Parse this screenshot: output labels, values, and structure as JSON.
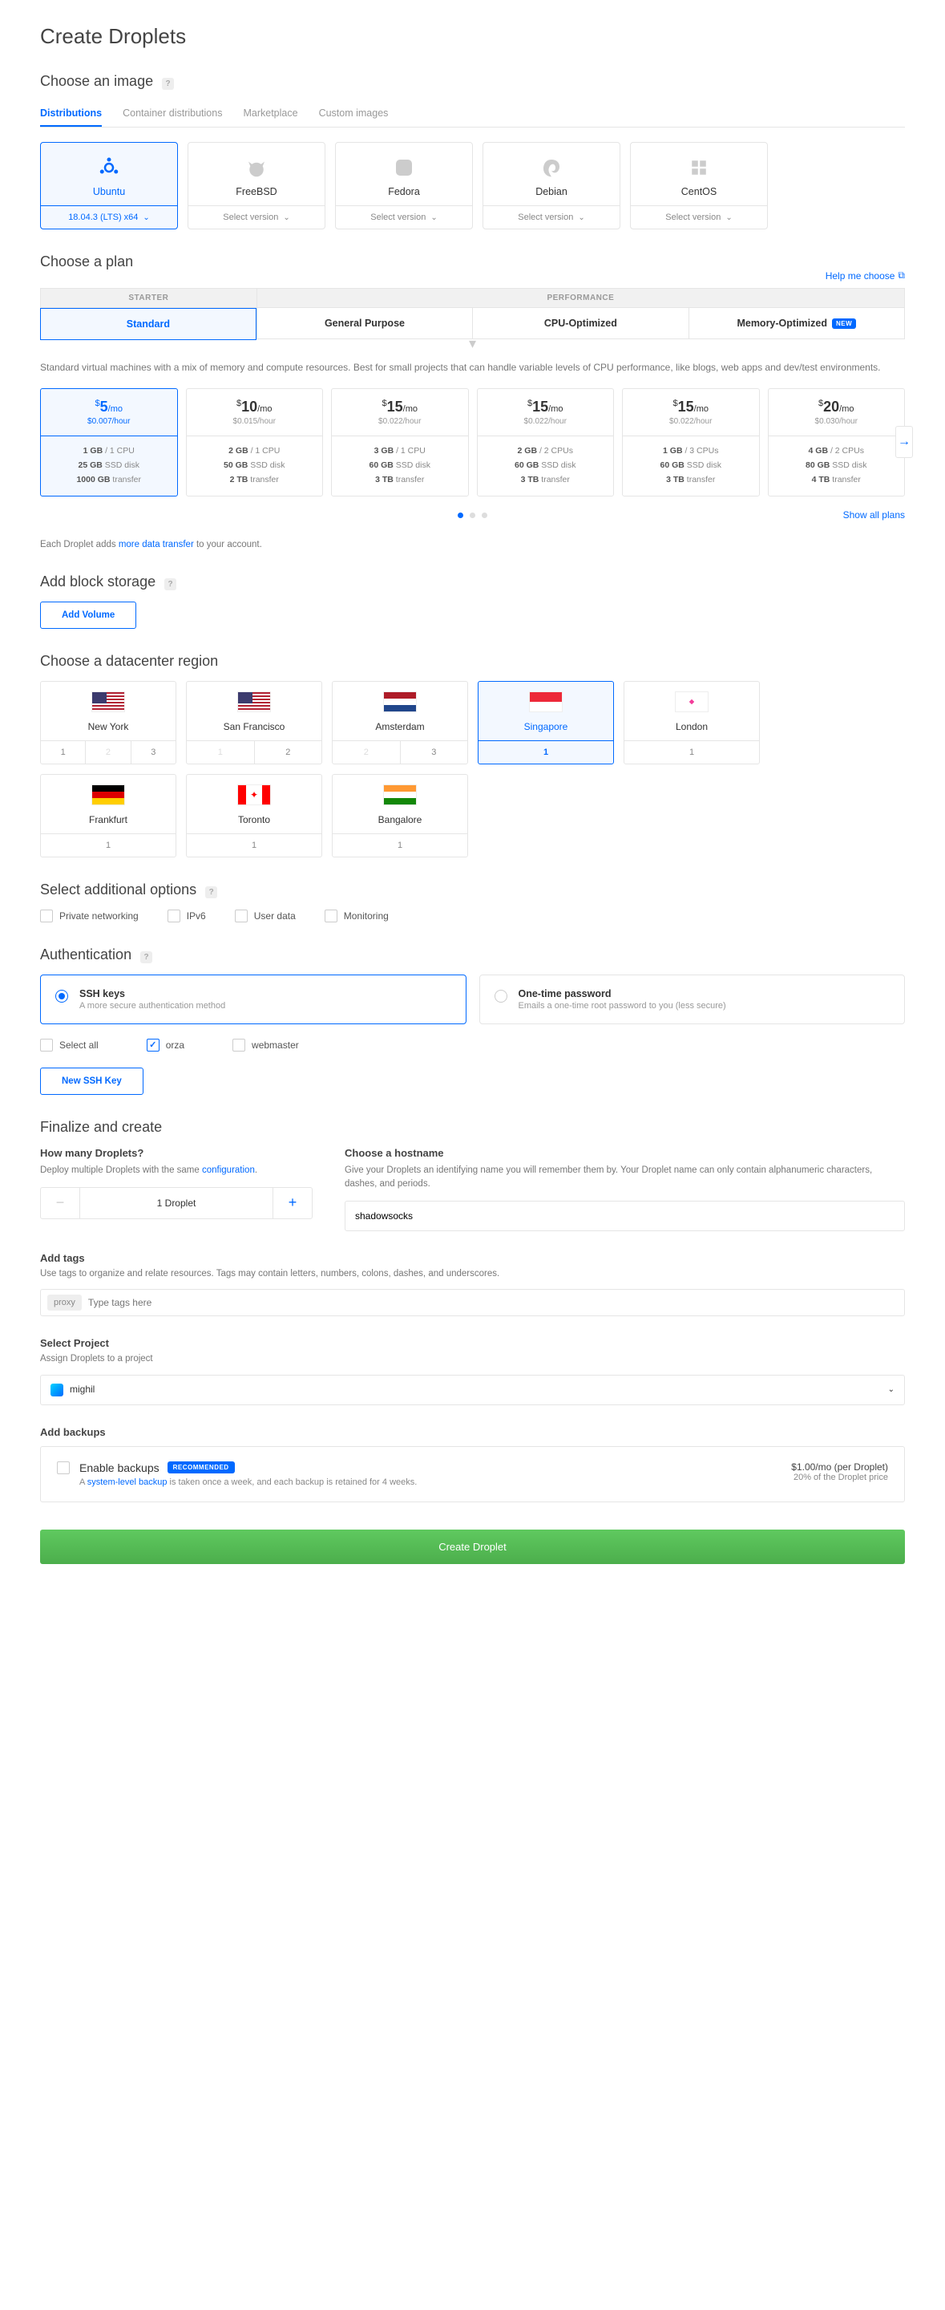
{
  "page_title": "Create Droplets",
  "image": {
    "heading": "Choose an image",
    "tabs": [
      "Distributions",
      "Container distributions",
      "Marketplace",
      "Custom images"
    ],
    "active_tab": 0,
    "distros": [
      {
        "name": "Ubuntu",
        "version": "18.04.3 (LTS) x64",
        "active": true,
        "color": "#0069ff"
      },
      {
        "name": "FreeBSD",
        "version": "Select version",
        "active": false,
        "color": "#ccc"
      },
      {
        "name": "Fedora",
        "version": "Select version",
        "active": false,
        "color": "#ccc"
      },
      {
        "name": "Debian",
        "version": "Select version",
        "active": false,
        "color": "#ccc"
      },
      {
        "name": "CentOS",
        "version": "Select version",
        "active": false,
        "color": "#ccc"
      }
    ]
  },
  "plan": {
    "heading": "Choose a plan",
    "help_link": "Help me choose",
    "cats": [
      "STARTER",
      "PERFORMANCE"
    ],
    "opts": [
      {
        "label": "Standard",
        "cat": 0,
        "active": true
      },
      {
        "label": "General Purpose",
        "cat": 1
      },
      {
        "label": "CPU-Optimized",
        "cat": 1
      },
      {
        "label": "Memory-Optimized",
        "cat": 1,
        "new": true
      }
    ],
    "new_badge": "NEW",
    "desc": "Standard virtual machines with a mix of memory and compute resources. Best for small projects that can handle variable levels of CPU performance, like blogs, web apps and dev/test environments.",
    "prices": [
      {
        "amt": "5",
        "hour": "$0.007/hour",
        "specs": [
          "1 GB / 1 CPU",
          "25 GB SSD disk",
          "1000 GB transfer"
        ],
        "active": true
      },
      {
        "amt": "10",
        "hour": "$0.015/hour",
        "specs": [
          "2 GB / 1 CPU",
          "50 GB SSD disk",
          "2 TB transfer"
        ]
      },
      {
        "amt": "15",
        "hour": "$0.022/hour",
        "specs": [
          "3 GB / 1 CPU",
          "60 GB SSD disk",
          "3 TB transfer"
        ]
      },
      {
        "amt": "15",
        "hour": "$0.022/hour",
        "specs": [
          "2 GB / 2 CPUs",
          "60 GB SSD disk",
          "3 TB transfer"
        ]
      },
      {
        "amt": "15",
        "hour": "$0.022/hour",
        "specs": [
          "1 GB / 3 CPUs",
          "60 GB SSD disk",
          "3 TB transfer"
        ]
      },
      {
        "amt": "20",
        "hour": "$0.030/hour",
        "specs": [
          "4 GB / 2 CPUs",
          "80 GB SSD disk",
          "4 TB transfer"
        ]
      }
    ],
    "show_all": "Show all plans",
    "transfer_note_a": "Each Droplet adds ",
    "transfer_note_link": "more data transfer",
    "transfer_note_b": " to your account."
  },
  "storage": {
    "heading": "Add block storage",
    "btn": "Add Volume"
  },
  "dc": {
    "heading": "Choose a datacenter region",
    "regions": [
      {
        "name": "New York",
        "nums": [
          "1",
          "2",
          "3"
        ],
        "disabled": [
          1
        ],
        "flag": "us"
      },
      {
        "name": "San Francisco",
        "nums": [
          "1",
          "2"
        ],
        "disabled": [
          0
        ],
        "flag": "us"
      },
      {
        "name": "Amsterdam",
        "nums": [
          "2",
          "3"
        ],
        "disabled": [
          0
        ],
        "flag": "nl"
      },
      {
        "name": "Singapore",
        "nums": [
          "1"
        ],
        "active": true,
        "active_num": 0,
        "flag": "sg"
      },
      {
        "name": "London",
        "nums": [
          "1"
        ],
        "flag": "gb"
      },
      {
        "name": "Frankfurt",
        "nums": [
          "1"
        ],
        "flag": "de"
      },
      {
        "name": "Toronto",
        "nums": [
          "1"
        ],
        "flag": "ca"
      },
      {
        "name": "Bangalore",
        "nums": [
          "1"
        ],
        "flag": "in"
      }
    ]
  },
  "opts": {
    "heading": "Select additional options",
    "items": [
      "Private networking",
      "IPv6",
      "User data",
      "Monitoring"
    ]
  },
  "auth": {
    "heading": "Authentication",
    "cards": [
      {
        "title": "SSH keys",
        "sub": "A more secure authentication method",
        "active": true
      },
      {
        "title": "One-time password",
        "sub": "Emails a one-time root password to you (less secure)"
      }
    ],
    "keys_select_all": "Select all",
    "keys": [
      {
        "label": "orza",
        "checked": true
      },
      {
        "label": "webmaster",
        "checked": false
      }
    ],
    "new_key_btn": "New SSH Key"
  },
  "finalize": {
    "heading": "Finalize and create",
    "count_h": "How many Droplets?",
    "count_desc_a": "Deploy multiple Droplets with the same ",
    "count_desc_link": "configuration",
    "count_val": "1 Droplet",
    "hostname_h": "Choose a hostname",
    "hostname_desc": "Give your Droplets an identifying name you will remember them by. Your Droplet name can only contain alphanumeric characters, dashes, and periods.",
    "hostname_val": "shadowsocks",
    "tags_h": "Add tags",
    "tags_desc": "Use tags to organize and relate resources. Tags may contain letters, numbers, colons, dashes, and underscores.",
    "tags": [
      "proxy"
    ],
    "tags_placeholder": "Type tags here",
    "project_h": "Select Project",
    "project_desc": "Assign Droplets to a project",
    "project_val": "mighil",
    "backups_h": "Add backups",
    "backups_title": "Enable backups",
    "backups_badge": "RECOMMENDED",
    "backups_desc_a": "A ",
    "backups_desc_link": "system-level backup",
    "backups_desc_b": " is taken once a week, and each backup is retained for 4 weeks.",
    "backups_price": "$1.00/mo (per Droplet)",
    "backups_price_sub": "20% of the Droplet price",
    "create_btn": "Create Droplet"
  }
}
